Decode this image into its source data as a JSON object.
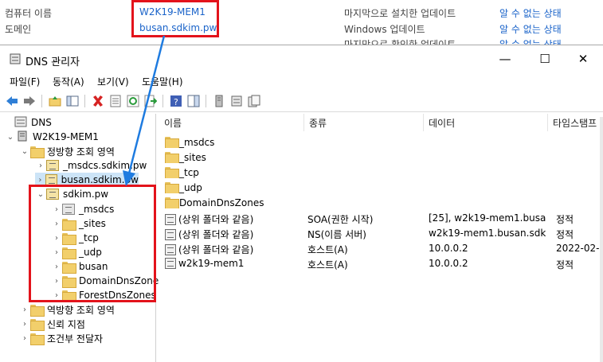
{
  "background": {
    "computer_name_label": "컴퓨터 이름",
    "domain_label": "도메인",
    "computer_name_value": "W2K19-MEM1",
    "domain_value": "busan.sdkim.pw",
    "update_label_1": "마지막으로 설치한 업데이트",
    "update_label_2": "Windows 업데이트",
    "update_label_3": "마지막으로 확인한 업데이트",
    "update_value_1": "알 수 없는 상태",
    "update_value_2": "알 수 없는 상태",
    "update_value_3": "알 수 없는 상태"
  },
  "window": {
    "title": "DNS 관리자",
    "minimize_label": "—",
    "maximize_label": "☐",
    "close_label": "✕"
  },
  "menu": [
    "파일(F)",
    "동작(A)",
    "보기(V)",
    "도움말(H)"
  ],
  "tree": {
    "root": "DNS",
    "server": "W2K19-MEM1",
    "forward_zones": "정방향 조회 영역",
    "zone_msdcs": "_msdcs.sdkim.pw",
    "zone_busan": "busan.sdkim.pw",
    "zone_sdkim": "sdkim.pw",
    "sub_msdcs": "_msdcs",
    "sub_sites": "_sites",
    "sub_tcp": "_tcp",
    "sub_udp": "_udp",
    "sub_busan": "busan",
    "sub_domaindns": "DomainDnsZones",
    "sub_forestdns": "ForestDnsZones",
    "reverse_zones": "역방향 조회 영역",
    "trust_points": "신뢰 지점",
    "conditional_forwarders": "조건부 전달자"
  },
  "list": {
    "columns": [
      "이름",
      "종류",
      "데이터",
      "타임스탬프"
    ],
    "rows": [
      {
        "name": "_msdcs",
        "type": "",
        "data": "",
        "ts": ""
      },
      {
        "name": "_sites",
        "type": "",
        "data": "",
        "ts": ""
      },
      {
        "name": "_tcp",
        "type": "",
        "data": "",
        "ts": ""
      },
      {
        "name": "_udp",
        "type": "",
        "data": "",
        "ts": ""
      },
      {
        "name": "DomainDnsZones",
        "type": "",
        "data": "",
        "ts": ""
      },
      {
        "name": "(상위 폴더와 같음)",
        "type": "SOA(권한 시작)",
        "data": "[25], w2k19-mem1.busa...",
        "ts": "정적"
      },
      {
        "name": "(상위 폴더와 같음)",
        "type": "NS(이름 서버)",
        "data": "w2k19-mem1.busan.sdki...",
        "ts": "정적"
      },
      {
        "name": "(상위 폴더와 같음)",
        "type": "호스트(A)",
        "data": "10.0.0.2",
        "ts": "2022-02-"
      },
      {
        "name": "w2k19-mem1",
        "type": "호스트(A)",
        "data": "10.0.0.2",
        "ts": "정적"
      }
    ]
  },
  "colors": {
    "annotation": "#e3131b",
    "arrow": "#1e7be0",
    "link": "#1a63c9",
    "selection": "#cce4f7"
  }
}
